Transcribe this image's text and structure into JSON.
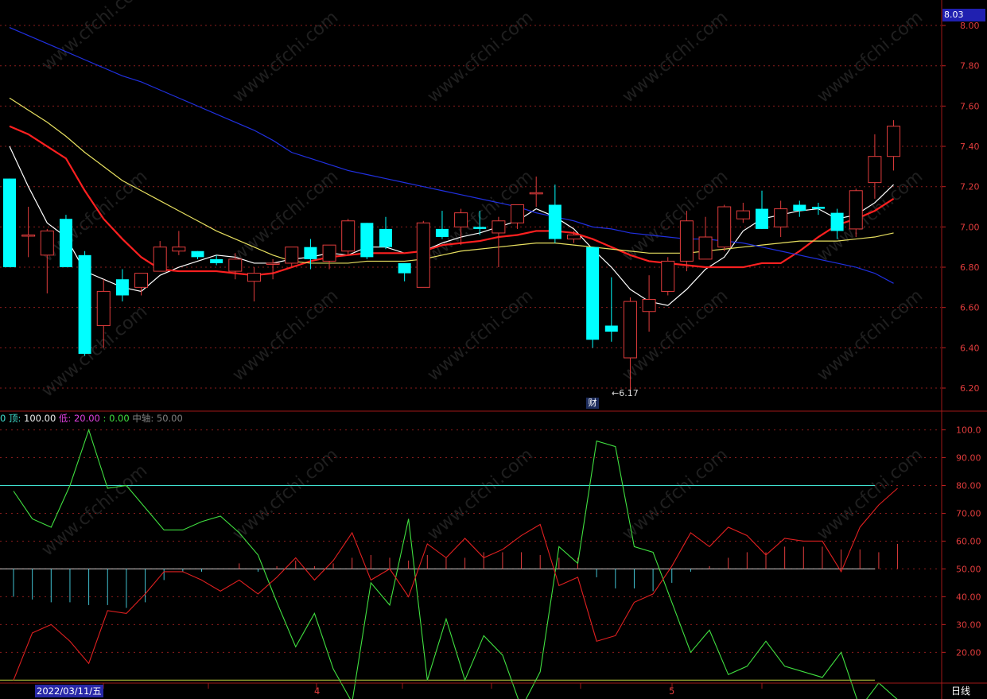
{
  "price_panel": {
    "top_label": "8.03",
    "y_ticks": [
      "8.00",
      "7.80",
      "7.60",
      "7.40",
      "7.20",
      "7.00",
      "6.80",
      "6.60",
      "6.40",
      "6.20"
    ],
    "min_marker": "←6.17",
    "event_marker": "财"
  },
  "indicator_panel": {
    "legend": {
      "prefix": "0",
      "top_label": "顶: ",
      "top_value": "100.00",
      "low_label": "低: ",
      "low_value": "20.00",
      "sep_label": ": ",
      "sep_value": "0.00",
      "mid_label": "中轴: ",
      "mid_value": "50.00"
    },
    "y_ticks": [
      "100.0",
      "90.00",
      "80.00",
      "70.00",
      "60.00",
      "50.00",
      "40.00",
      "30.00",
      "20.00"
    ]
  },
  "time_axis": {
    "selected_date": "2022/03/11/五",
    "month_labels": [
      "4",
      "5"
    ],
    "period_label": "日线"
  },
  "watermark_text": "www.cfchi.com",
  "colors": {
    "background": "#000000",
    "grid_red": "#8a1c1c",
    "up_candle": "#e03c3c",
    "down_candle": "#00ffff",
    "ma_white": "#ffffff",
    "ma_red": "#ff2020",
    "ma_yellow": "#e8e060",
    "ma_blue": "#2030e0",
    "osc_green": "#40e040",
    "osc_red": "#e02020",
    "level_cyan": "#40e0d0"
  },
  "chart_data": [
    {
      "type": "candlestick",
      "ylim": [
        6.12,
        8.03
      ],
      "candles": [
        {
          "o": 7.24,
          "h": 7.24,
          "l": 6.8,
          "c": 6.8
        },
        {
          "o": 6.96,
          "h": 7.1,
          "l": 6.85,
          "c": 6.96
        },
        {
          "o": 6.86,
          "h": 6.99,
          "l": 6.67,
          "c": 6.98
        },
        {
          "o": 7.04,
          "h": 7.06,
          "l": 6.8,
          "c": 6.8
        },
        {
          "o": 6.86,
          "h": 6.88,
          "l": 6.36,
          "c": 6.37
        },
        {
          "o": 6.51,
          "h": 6.74,
          "l": 6.4,
          "c": 6.68
        },
        {
          "o": 6.74,
          "h": 6.79,
          "l": 6.63,
          "c": 6.66
        },
        {
          "o": 6.7,
          "h": 6.77,
          "l": 6.66,
          "c": 6.77
        },
        {
          "o": 6.78,
          "h": 6.93,
          "l": 6.78,
          "c": 6.9
        },
        {
          "o": 6.88,
          "h": 6.98,
          "l": 6.86,
          "c": 6.9
        },
        {
          "o": 6.88,
          "h": 6.88,
          "l": 6.84,
          "c": 6.85
        },
        {
          "o": 6.84,
          "h": 6.86,
          "l": 6.81,
          "c": 6.82
        },
        {
          "o": 6.78,
          "h": 6.87,
          "l": 6.74,
          "c": 6.84
        },
        {
          "o": 6.73,
          "h": 6.8,
          "l": 6.63,
          "c": 6.77
        },
        {
          "o": 6.82,
          "h": 6.84,
          "l": 6.74,
          "c": 6.82
        },
        {
          "o": 6.82,
          "h": 6.9,
          "l": 6.8,
          "c": 6.9
        },
        {
          "o": 6.9,
          "h": 6.94,
          "l": 6.79,
          "c": 6.84
        },
        {
          "o": 6.83,
          "h": 6.91,
          "l": 6.79,
          "c": 6.91
        },
        {
          "o": 6.88,
          "h": 7.04,
          "l": 6.86,
          "c": 7.03
        },
        {
          "o": 7.02,
          "h": 7.02,
          "l": 6.84,
          "c": 6.85
        },
        {
          "o": 6.99,
          "h": 7.05,
          "l": 6.89,
          "c": 6.9
        },
        {
          "o": 6.82,
          "h": 6.82,
          "l": 6.73,
          "c": 6.77
        },
        {
          "o": 6.7,
          "h": 7.03,
          "l": 6.7,
          "c": 7.02
        },
        {
          "o": 6.99,
          "h": 7.08,
          "l": 6.94,
          "c": 6.95
        },
        {
          "o": 7.0,
          "h": 7.09,
          "l": 6.91,
          "c": 7.07
        },
        {
          "o": 7.0,
          "h": 7.08,
          "l": 6.96,
          "c": 6.99
        },
        {
          "o": 6.97,
          "h": 7.05,
          "l": 6.8,
          "c": 7.03
        },
        {
          "o": 7.02,
          "h": 7.11,
          "l": 6.99,
          "c": 7.11
        },
        {
          "o": 7.17,
          "h": 7.25,
          "l": 7.1,
          "c": 7.17
        },
        {
          "o": 7.11,
          "h": 7.21,
          "l": 6.92,
          "c": 6.94
        },
        {
          "o": 6.94,
          "h": 6.98,
          "l": 6.92,
          "c": 6.96
        },
        {
          "o": 6.9,
          "h": 6.9,
          "l": 6.4,
          "c": 6.44
        },
        {
          "o": 6.51,
          "h": 6.75,
          "l": 6.43,
          "c": 6.48
        },
        {
          "o": 6.35,
          "h": 6.65,
          "l": 6.17,
          "c": 6.63
        },
        {
          "o": 6.58,
          "h": 6.76,
          "l": 6.48,
          "c": 6.64
        },
        {
          "o": 6.68,
          "h": 6.85,
          "l": 6.66,
          "c": 6.83
        },
        {
          "o": 6.83,
          "h": 7.08,
          "l": 6.78,
          "c": 7.03
        },
        {
          "o": 6.84,
          "h": 7.05,
          "l": 6.84,
          "c": 6.95
        },
        {
          "o": 6.9,
          "h": 7.11,
          "l": 6.88,
          "c": 7.1
        },
        {
          "o": 7.04,
          "h": 7.12,
          "l": 7.02,
          "c": 7.08
        },
        {
          "o": 7.09,
          "h": 7.18,
          "l": 6.99,
          "c": 6.99
        },
        {
          "o": 7.0,
          "h": 7.13,
          "l": 6.95,
          "c": 7.09
        },
        {
          "o": 7.11,
          "h": 7.13,
          "l": 7.05,
          "c": 7.08
        },
        {
          "o": 7.1,
          "h": 7.12,
          "l": 7.06,
          "c": 7.09
        },
        {
          "o": 7.07,
          "h": 7.09,
          "l": 6.94,
          "c": 6.98
        },
        {
          "o": 6.99,
          "h": 7.19,
          "l": 6.95,
          "c": 7.18
        },
        {
          "o": 7.22,
          "h": 7.46,
          "l": 7.14,
          "c": 7.35
        },
        {
          "o": 7.35,
          "h": 7.53,
          "l": 7.28,
          "c": 7.5
        }
      ],
      "ma_series": [
        {
          "name": "",
          "color": "#ffffff",
          "values": [
            7.4,
            7.2,
            7.02,
            6.95,
            6.78,
            6.74,
            6.7,
            6.68,
            6.76,
            6.8,
            6.83,
            6.86,
            6.85,
            6.82,
            6.82,
            6.84,
            6.85,
            6.87,
            6.86,
            6.9,
            6.9,
            6.87,
            6.88,
            6.92,
            6.95,
            6.97,
            7.0,
            7.03,
            7.09,
            7.05,
            6.99,
            6.89,
            6.8,
            6.69,
            6.63,
            6.61,
            6.69,
            6.79,
            6.85,
            6.98,
            7.04,
            7.06,
            7.08,
            7.09,
            7.04,
            7.06,
            7.12,
            7.21
          ]
        },
        {
          "name": "",
          "color": "#ff2020",
          "values": [
            7.5,
            7.46,
            7.4,
            7.34,
            7.18,
            7.04,
            6.94,
            6.85,
            6.79,
            6.78,
            6.78,
            6.78,
            6.77,
            6.76,
            6.77,
            6.8,
            6.83,
            6.85,
            6.86,
            6.87,
            6.87,
            6.87,
            6.88,
            6.91,
            6.92,
            6.93,
            6.95,
            6.96,
            6.98,
            6.98,
            6.97,
            6.94,
            6.9,
            6.86,
            6.83,
            6.82,
            6.81,
            6.8,
            6.8,
            6.8,
            6.82,
            6.82,
            6.88,
            6.95,
            7.01,
            7.04,
            7.08,
            7.14
          ]
        },
        {
          "name": "",
          "color": "#e8e060",
          "values": [
            7.64,
            7.58,
            7.52,
            7.45,
            7.37,
            7.3,
            7.23,
            7.18,
            7.13,
            7.08,
            7.03,
            6.98,
            6.94,
            6.9,
            6.86,
            6.83,
            6.82,
            6.82,
            6.82,
            6.83,
            6.83,
            6.83,
            6.84,
            6.86,
            6.88,
            6.89,
            6.9,
            6.91,
            6.92,
            6.92,
            6.91,
            6.9,
            6.89,
            6.88,
            6.87,
            6.87,
            6.87,
            6.88,
            6.89,
            6.9,
            6.91,
            6.92,
            6.93,
            6.93,
            6.93,
            6.94,
            6.95,
            6.97
          ]
        },
        {
          "name": "",
          "color": "#2030e0",
          "values": [
            7.99,
            7.95,
            7.91,
            7.87,
            7.83,
            7.79,
            7.75,
            7.72,
            7.68,
            7.64,
            7.6,
            7.56,
            7.52,
            7.48,
            7.43,
            7.37,
            7.34,
            7.31,
            7.28,
            7.26,
            7.24,
            7.22,
            7.2,
            7.18,
            7.16,
            7.14,
            7.12,
            7.1,
            7.07,
            7.05,
            7.03,
            7.0,
            6.99,
            6.97,
            6.96,
            6.95,
            6.94,
            6.94,
            6.93,
            6.92,
            6.9,
            6.88,
            6.86,
            6.84,
            6.82,
            6.8,
            6.77,
            6.72
          ]
        }
      ]
    },
    {
      "type": "line",
      "ylim": [
        10,
        100
      ],
      "reference_lines": [
        80,
        50,
        10
      ],
      "series": [
        {
          "name": "",
          "color": "#40e040",
          "values": [
            78,
            68,
            65,
            80,
            100,
            79,
            80,
            72,
            64,
            64,
            67,
            69,
            63,
            55,
            38,
            22,
            34,
            14,
            2,
            45,
            37,
            68,
            10,
            32,
            10,
            26,
            19,
            0,
            13,
            58,
            52,
            96,
            94,
            58,
            56,
            38,
            20,
            28,
            12,
            15,
            24,
            15,
            13,
            11,
            20,
            0,
            9,
            3
          ]
        },
        {
          "name": "",
          "color": "#e02020",
          "values": [
            10,
            27,
            30,
            24,
            16,
            35,
            34,
            41,
            49,
            49,
            46,
            42,
            46,
            41,
            47,
            54,
            46,
            53,
            63,
            46,
            50,
            40,
            59,
            54,
            61,
            54,
            57,
            62,
            66,
            44,
            47,
            24,
            26,
            38,
            41,
            51,
            63,
            58,
            65,
            62,
            55,
            61,
            60,
            60,
            49,
            65,
            73,
            79
          ]
        },
        {
          "name": "",
          "type": "bar",
          "color": "#e03c3c",
          "values": [
            -10,
            -11,
            -12,
            -12,
            -13,
            -13,
            -14,
            -12,
            -4,
            -1,
            -1,
            0,
            2,
            -1,
            1,
            3,
            1,
            2,
            4,
            5,
            4,
            3,
            5,
            4,
            4,
            6,
            6,
            6,
            5,
            4,
            4,
            -3,
            -7,
            -7,
            -8,
            -5,
            -1,
            1,
            4,
            6,
            6,
            8,
            8,
            8,
            7,
            7,
            6,
            9
          ]
        }
      ]
    }
  ]
}
